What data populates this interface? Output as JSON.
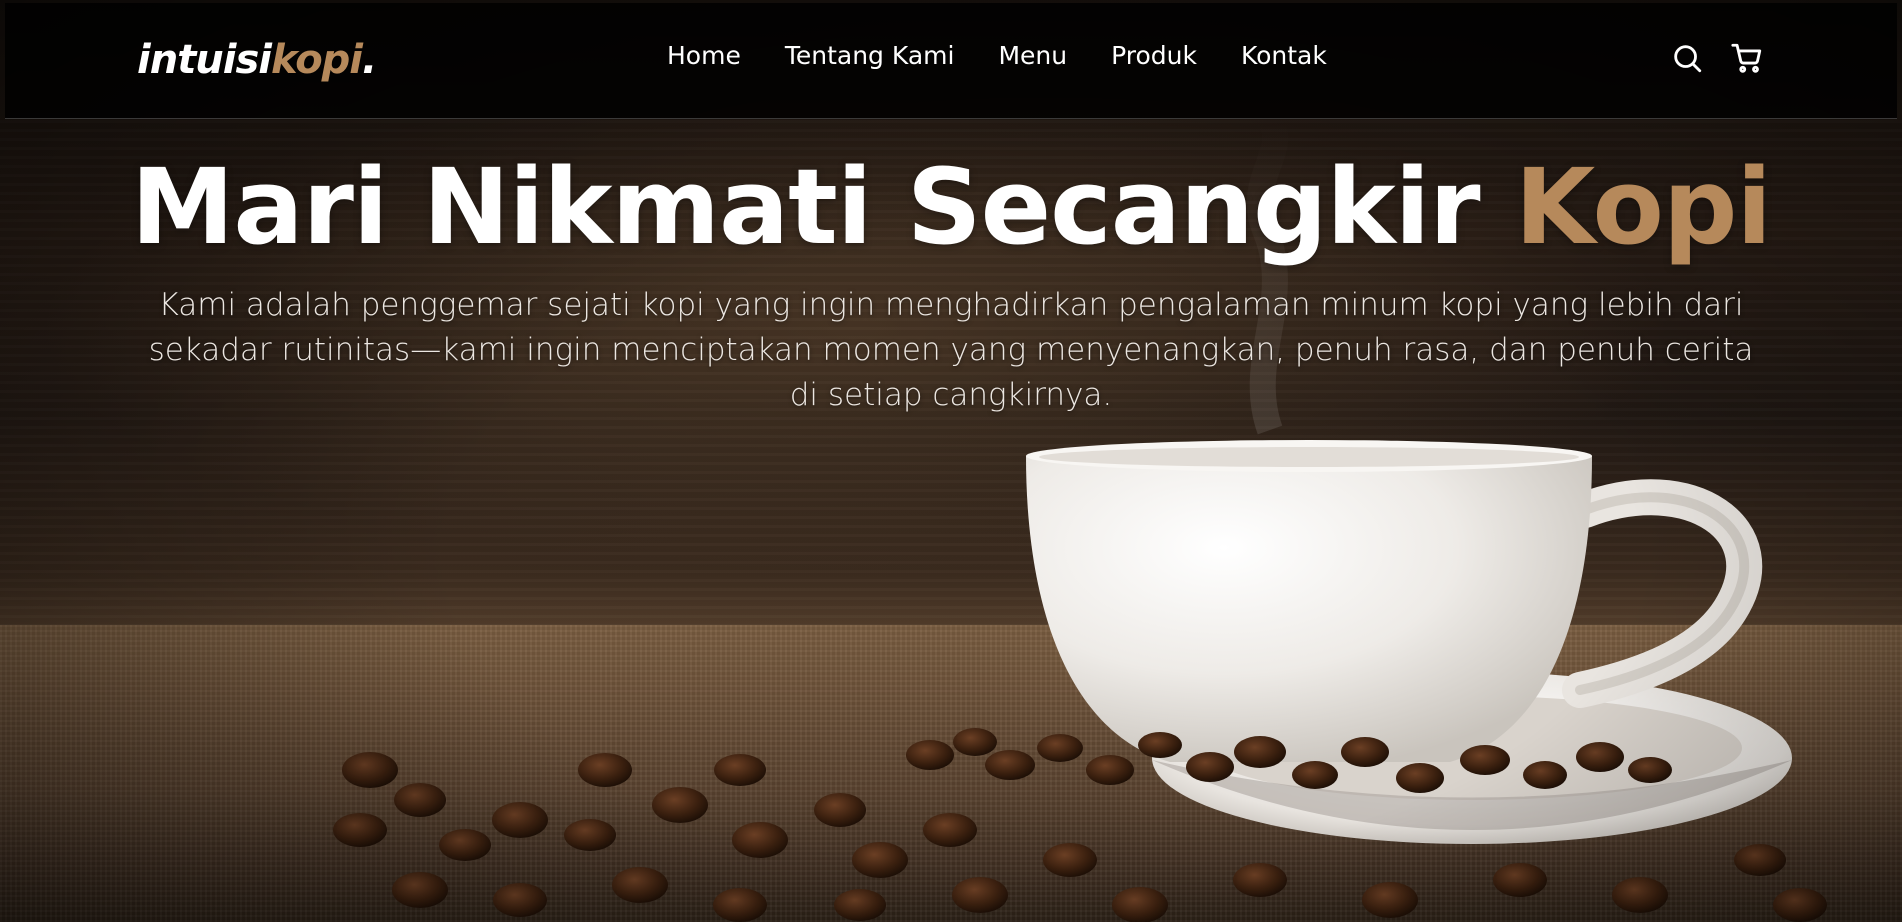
{
  "brand": {
    "name_main": "intuisi",
    "name_accent": "kopi",
    "name_dot": ".",
    "accent_color": "#b6895b"
  },
  "nav": {
    "links": [
      "Home",
      "Tentang Kami",
      "Menu",
      "Produk",
      "Kontak"
    ],
    "icons": [
      "search-icon",
      "shopping-cart-icon"
    ]
  },
  "hero": {
    "title_main": "Mari Nikmati Secangkir",
    "title_accent": "Kopi",
    "description": "Kami adalah penggemar sejati kopi yang ingin menghadirkan pengalaman minum kopi yang lebih dari sekadar rutinitas—kami ingin menciptakan momen yang menyenangkan, penuh rasa, dan penuh cerita di setiap cangkirnya."
  }
}
